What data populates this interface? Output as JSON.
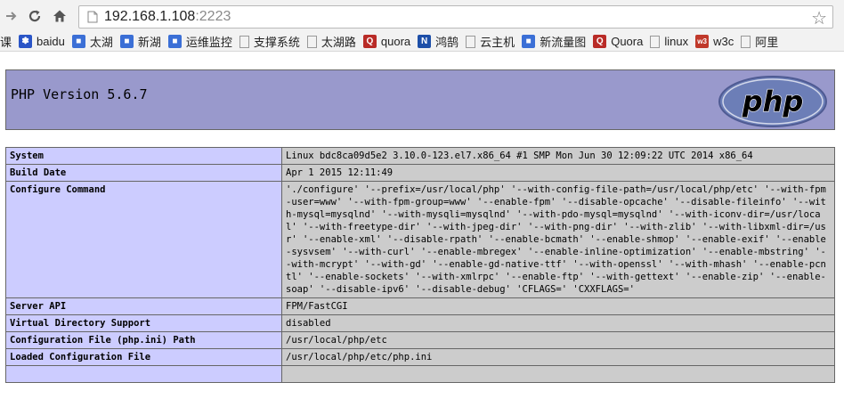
{
  "browser": {
    "url_host": "192.168.1.108",
    "url_port": ":2223",
    "bookmarks": [
      {
        "label": "课",
        "icon": "folder-icon"
      },
      {
        "label": "baidu",
        "icon": "baidu-paw-icon"
      },
      {
        "label": "太湖",
        "icon": "bookmark-icon"
      },
      {
        "label": "新湖",
        "icon": "bookmark-icon"
      },
      {
        "label": "运维监控",
        "icon": "bookmark-icon"
      },
      {
        "label": "支撑系统",
        "icon": "page-icon"
      },
      {
        "label": "太湖路",
        "icon": "page-icon"
      },
      {
        "label": "quora",
        "icon": "quora-icon"
      },
      {
        "label": "鸿鹄",
        "icon": "n-logo-icon"
      },
      {
        "label": "云主机",
        "icon": "page-icon"
      },
      {
        "label": "新流量图",
        "icon": "bookmark-icon"
      },
      {
        "label": "Quora",
        "icon": "quora-icon"
      },
      {
        "label": "linux",
        "icon": "page-icon"
      },
      {
        "label": "w3c",
        "icon": "w3c-icon"
      },
      {
        "label": "阿里",
        "icon": "page-icon"
      }
    ]
  },
  "php": {
    "title": "PHP Version 5.6.7",
    "logo_text": "php",
    "rows": [
      {
        "key": "System",
        "value": "Linux bdc8ca09d5e2 3.10.0-123.el7.x86_64 #1 SMP Mon Jun 30 12:09:22 UTC 2014 x86_64"
      },
      {
        "key": "Build Date",
        "value": "Apr 1 2015 12:11:49"
      },
      {
        "key": "Configure Command",
        "value": "'./configure' '--prefix=/usr/local/php' '--with-config-file-path=/usr/local/php/etc' '--with-fpm-user=www' '--with-fpm-group=www' '--enable-fpm' '--disable-opcache' '--disable-fileinfo' '--with-mysql=mysqlnd' '--with-mysqli=mysqlnd' '--with-pdo-mysql=mysqlnd' '--with-iconv-dir=/usr/local' '--with-freetype-dir' '--with-jpeg-dir' '--with-png-dir' '--with-zlib' '--with-libxml-dir=/usr' '--enable-xml' '--disable-rpath' '--enable-bcmath' '--enable-shmop' '--enable-exif' '--enable-sysvsem' '--with-curl' '--enable-mbregex' '--enable-inline-optimization' '--enable-mbstring' '--with-mcrypt' '--with-gd' '--enable-gd-native-ttf' '--with-openssl' '--with-mhash' '--enable-pcntl' '--enable-sockets' '--with-xmlrpc' '--enable-ftp' '--with-gettext' '--enable-zip' '--enable-soap' '--disable-ipv6' '--disable-debug' 'CFLAGS=' 'CXXFLAGS='"
      },
      {
        "key": "Server API",
        "value": "FPM/FastCGI"
      },
      {
        "key": "Virtual Directory Support",
        "value": "disabled"
      },
      {
        "key": "Configuration File (php.ini) Path",
        "value": "/usr/local/php/etc"
      },
      {
        "key": "Loaded Configuration File",
        "value": "/usr/local/php/etc/php.ini"
      },
      {
        "key": "",
        "value": ""
      }
    ]
  },
  "colors": {
    "header_bg": "#9999cc",
    "key_bg": "#ccccff",
    "value_bg": "#cccccc"
  }
}
